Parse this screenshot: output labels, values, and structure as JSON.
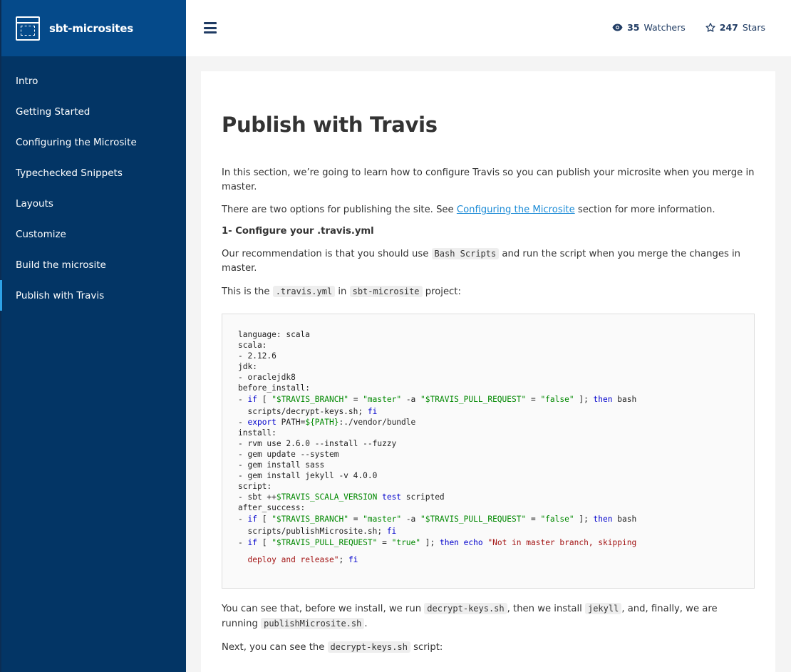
{
  "brand": {
    "name": "sbt-microsites",
    "icon": "window-icon"
  },
  "nav": {
    "items": [
      {
        "label": "Intro",
        "active": false
      },
      {
        "label": "Getting Started",
        "active": false
      },
      {
        "label": "Configuring the Microsite",
        "active": false
      },
      {
        "label": "Typechecked Snippets",
        "active": false
      },
      {
        "label": "Layouts",
        "active": false
      },
      {
        "label": "Customize",
        "active": false
      },
      {
        "label": "Build the microsite",
        "active": false
      },
      {
        "label": "Publish with Travis",
        "active": true
      }
    ]
  },
  "header": {
    "watchers": {
      "count": "35",
      "label": "Watchers"
    },
    "stars": {
      "count": "247",
      "label": "Stars"
    }
  },
  "page": {
    "title": "Publish with Travis",
    "intro": "In this section, we’re going to learn how to configure Travis so you can publish your microsite when you merge in master.",
    "options_pre": "There are two options for publishing the site. See ",
    "options_link": "Configuring the Microsite",
    "options_post": " section for more information.",
    "step1_heading": "1- Configure your .travis.yml",
    "rec_pre": "Our recommendation is that you should use ",
    "rec_code": "Bash Scripts",
    "rec_post": " and run the script when you merge the changes in master.",
    "this_pre": "This is the ",
    "this_code1": ".travis.yml",
    "this_mid": " in ",
    "this_code2": "sbt-microsite",
    "this_post": " project:",
    "after_pre": "You can see that, before we install, we run ",
    "after_code1": "decrypt-keys.sh",
    "after_mid1": ", then we install ",
    "after_code2": "jekyll",
    "after_mid2": ", and, finally, we are running ",
    "after_code3": "publishMicrosite.sh",
    "after_post": ".",
    "next_pre": "Next, you can see the ",
    "next_code": "decrypt-keys.sh",
    "next_post": " script:"
  },
  "code": {
    "l1": "language: scala",
    "l2": "scala:",
    "l3": "- 2.12.6",
    "l4": "jdk:",
    "l5": "- oraclejdk8",
    "l6": "before_install:",
    "l7_dash": "- ",
    "l7_if": "if",
    "l7_a": " [ ",
    "l7_s1": "\"$TRAVIS_BRANCH\"",
    "l7_b": " = ",
    "l7_s2": "\"master\"",
    "l7_c": " -a ",
    "l7_s3": "\"$TRAVIS_PULL_REQUEST\"",
    "l7_d": " = ",
    "l7_s4": "\"false\"",
    "l7_e": " ]; ",
    "l7_then": "then",
    "l7_f": " bash",
    "l8_a": "  scripts/decrypt-keys.sh; ",
    "l8_fi": "fi",
    "l9_dash": "- ",
    "l9_export": "export",
    "l9_a": " PATH=",
    "l9_var": "${PATH}",
    "l9_b": ":./vendor/bundle",
    "l10": "install:",
    "l11": "- rvm use 2.6.0 --install --fuzzy",
    "l12": "- gem update --system",
    "l13": "- gem install sass",
    "l14": "- gem install jekyll -v 4.0.0",
    "l15": "script:",
    "l16_a": "- sbt ++",
    "l16_var": "$TRAVIS_SCALA_VERSION",
    "l16_b": " ",
    "l16_test": "test",
    "l16_c": " scripted",
    "l17": "after_success:",
    "l18_dash": "- ",
    "l18_if": "if",
    "l18_a": " [ ",
    "l18_s1": "\"$TRAVIS_BRANCH\"",
    "l18_b": " = ",
    "l18_s2": "\"master\"",
    "l18_c": " -a ",
    "l18_s3": "\"$TRAVIS_PULL_REQUEST\"",
    "l18_d": " = ",
    "l18_s4": "\"false\"",
    "l18_e": " ]; ",
    "l18_then": "then",
    "l18_f": " bash",
    "l19_a": "  scripts/publishMicrosite.sh; ",
    "l19_fi": "fi",
    "l20_dash": "- ",
    "l20_if": "if",
    "l20_a": " [ ",
    "l20_s1": "\"$TRAVIS_PULL_REQUEST\"",
    "l20_b": " = ",
    "l20_s2": "\"true\"",
    "l20_c": " ]; ",
    "l20_then": "then",
    "l20_d": " ",
    "l20_echo": "echo",
    "l20_e": " ",
    "l20_s3": "\"Not in master branch, skipping",
    "l21_s": "  deploy and release\"",
    "l21_a": "; ",
    "l21_fi": "fi"
  }
}
